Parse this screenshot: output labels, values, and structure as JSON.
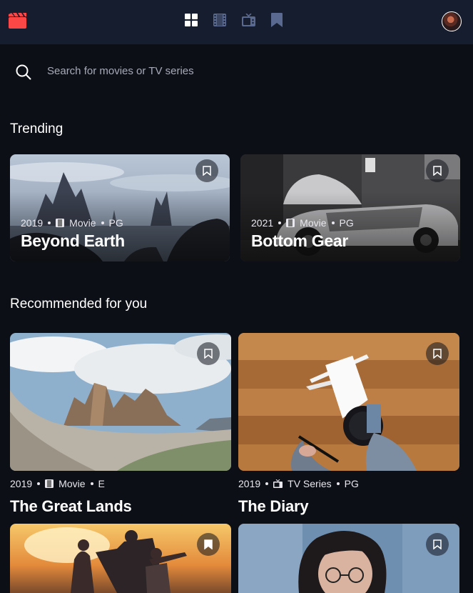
{
  "search": {
    "placeholder": "Search for movies or TV series"
  },
  "sections": {
    "trending_title": "Trending",
    "recommended_title": "Recommended for you"
  },
  "trending": [
    {
      "year": "2019",
      "category": "Movie",
      "rating": "PG",
      "title": "Beyond Earth"
    },
    {
      "year": "2021",
      "category": "Movie",
      "rating": "PG",
      "title": "Bottom Gear"
    }
  ],
  "recommended": [
    {
      "year": "2019",
      "category": "Movie",
      "rating": "E",
      "title": "The Great Lands"
    },
    {
      "year": "2019",
      "category": "TV Series",
      "rating": "PG",
      "title": "The Diary"
    },
    {
      "year": "",
      "category": "",
      "rating": "",
      "title": ""
    },
    {
      "year": "",
      "category": "",
      "rating": "",
      "title": ""
    }
  ],
  "icons": {
    "logo": "movie-clapper-icon",
    "nav": [
      "home-grid-icon",
      "movies-film-icon",
      "tv-series-icon",
      "bookmark-nav-icon"
    ],
    "search": "search-icon",
    "bookmark": "bookmark-icon"
  },
  "colors": {
    "background": "#0d0f17",
    "nav_bg": "#161d2f",
    "accent_red": "#fc4747",
    "nav_inactive": "#5a698f",
    "active": "#ffffff"
  }
}
